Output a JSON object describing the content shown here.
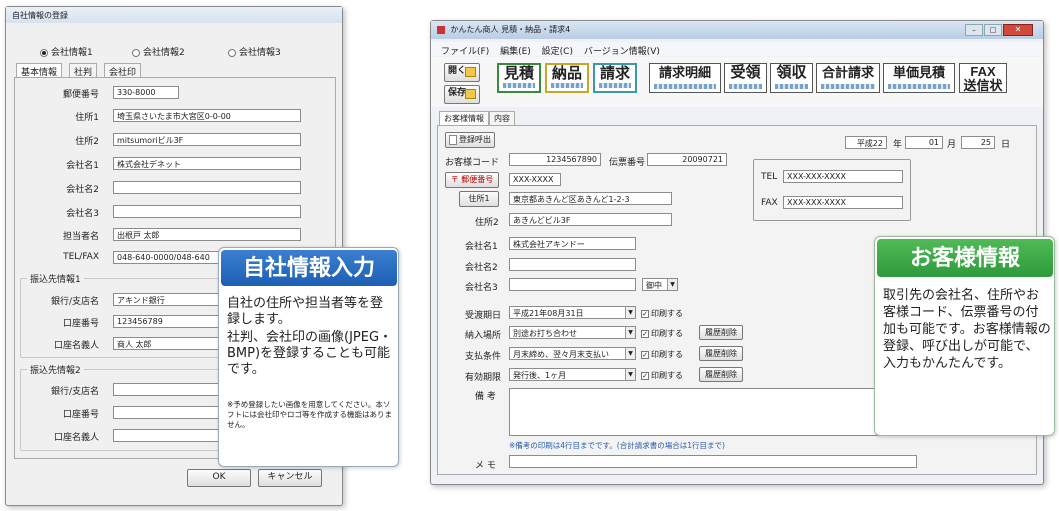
{
  "left": {
    "title": "自社情報の登録",
    "radios": [
      "会社情報1",
      "会社情報2",
      "会社情報3"
    ],
    "tabs": [
      "基本情報",
      "社判",
      "会社印"
    ],
    "fields": [
      {
        "label": "郵便番号",
        "value": "330-8000"
      },
      {
        "label": "住所1",
        "value": "埼玉県さいたま市大宮区0-0-00"
      },
      {
        "label": "住所2",
        "value": "mitsumoriビル3F"
      },
      {
        "label": "会社名1",
        "value": "株式会社デネット"
      },
      {
        "label": "会社名2",
        "value": ""
      },
      {
        "label": "会社名3",
        "value": ""
      },
      {
        "label": "担当者名",
        "value": "出根戸 太郎"
      },
      {
        "label": "TEL/FAX",
        "value": "048-640-0000/048-640"
      }
    ],
    "bank1": {
      "title": "振込先情報1",
      "rows": [
        {
          "label": "銀行/支店名",
          "value": "アキンド銀行"
        },
        {
          "label": "口座番号",
          "value": "123456789"
        },
        {
          "label": "口座名義人",
          "value": "商人 太郎"
        }
      ]
    },
    "bank2": {
      "title": "振込先情報2",
      "rows": [
        {
          "label": "銀行/支店名",
          "value": ""
        },
        {
          "label": "口座番号",
          "value": ""
        },
        {
          "label": "口座名義人",
          "value": ""
        }
      ]
    },
    "ok": "OK",
    "cancel": "キャンセル"
  },
  "callout_left": {
    "heading": "自社情報入力",
    "body1": "自社の住所や担当者等を登録します。",
    "body2": "社判、会社印の画像(JPEG・BMP)を登録することも可能です。",
    "note": "※予め登録したい画像を用意してください。本ソフトには会社印やロゴ等を作成する機能はありません。"
  },
  "right": {
    "title": "かんたん商人 見積・納品・請求4",
    "menu": [
      "ファイル(F)",
      "編集(E)",
      "設定(C)",
      "バージョン情報(V)"
    ],
    "open": "開く",
    "save": "保存",
    "docs": [
      "見積",
      "納品",
      "請求",
      "請求明細",
      "受領",
      "領収",
      "合計請求",
      "単価見積"
    ],
    "fax": [
      "FAX",
      "送信状"
    ],
    "tabs": [
      "お客様情報",
      "内容"
    ],
    "call_btn": "登録呼出",
    "date": {
      "era": "平成22",
      "y": "年",
      "m_val": "01",
      "m": "月",
      "d_val": "25",
      "d": "日"
    },
    "cust_code_label": "お客様コード",
    "cust_code": "1234567890",
    "slip_label": "伝票番号",
    "slip": "20090721",
    "zip_btn": "〒 郵便番号",
    "zip": "XXX-XXXX",
    "addr1_btn": "住所1",
    "addr1": "東京都あきんど区あきんど1-2-3",
    "addr2_label": "住所2",
    "addr2": "あきんどビル3F",
    "tel_label": "TEL",
    "tel": "XXX-XXX-XXXX",
    "fax_label": "FAX",
    "fax_val": "XXX-XXX-XXXX",
    "co1_label": "会社名1",
    "co1": "株式会社アキンドー",
    "co2_label": "会社名2",
    "co3_label": "会社名3",
    "honorific": "御中",
    "rows": [
      {
        "label": "受渡期日",
        "value": "平成21年08月31日",
        "chk": "印刷する",
        "hist": ""
      },
      {
        "label": "納入場所",
        "value": "別途お打ち合わせ",
        "chk": "印刷する",
        "hist": "履歴削除"
      },
      {
        "label": "支払条件",
        "value": "月末締め、翌々月末支払い",
        "chk": "印刷する",
        "hist": "履歴削除"
      },
      {
        "label": "有効期限",
        "value": "発行後、1ヶ月",
        "chk": "印刷する",
        "hist": "履歴削除"
      }
    ],
    "remarks_label": "備 考",
    "remarks_note": "※備考の印刷は4行目までです。(合計請求書の場合は1行目まで)",
    "memo_label": "メ モ"
  },
  "callout_right": {
    "heading": "お客様情報",
    "body": "取引先の会社名、住所やお客様コード、伝票番号の付加も可能です。お客様情報の登録、呼び出しが可能で、入力もかんたんです。"
  },
  "colors": {
    "blue_callout": "#1d5fb4",
    "green_callout": "#2f9a3b",
    "title_text": "#333"
  }
}
